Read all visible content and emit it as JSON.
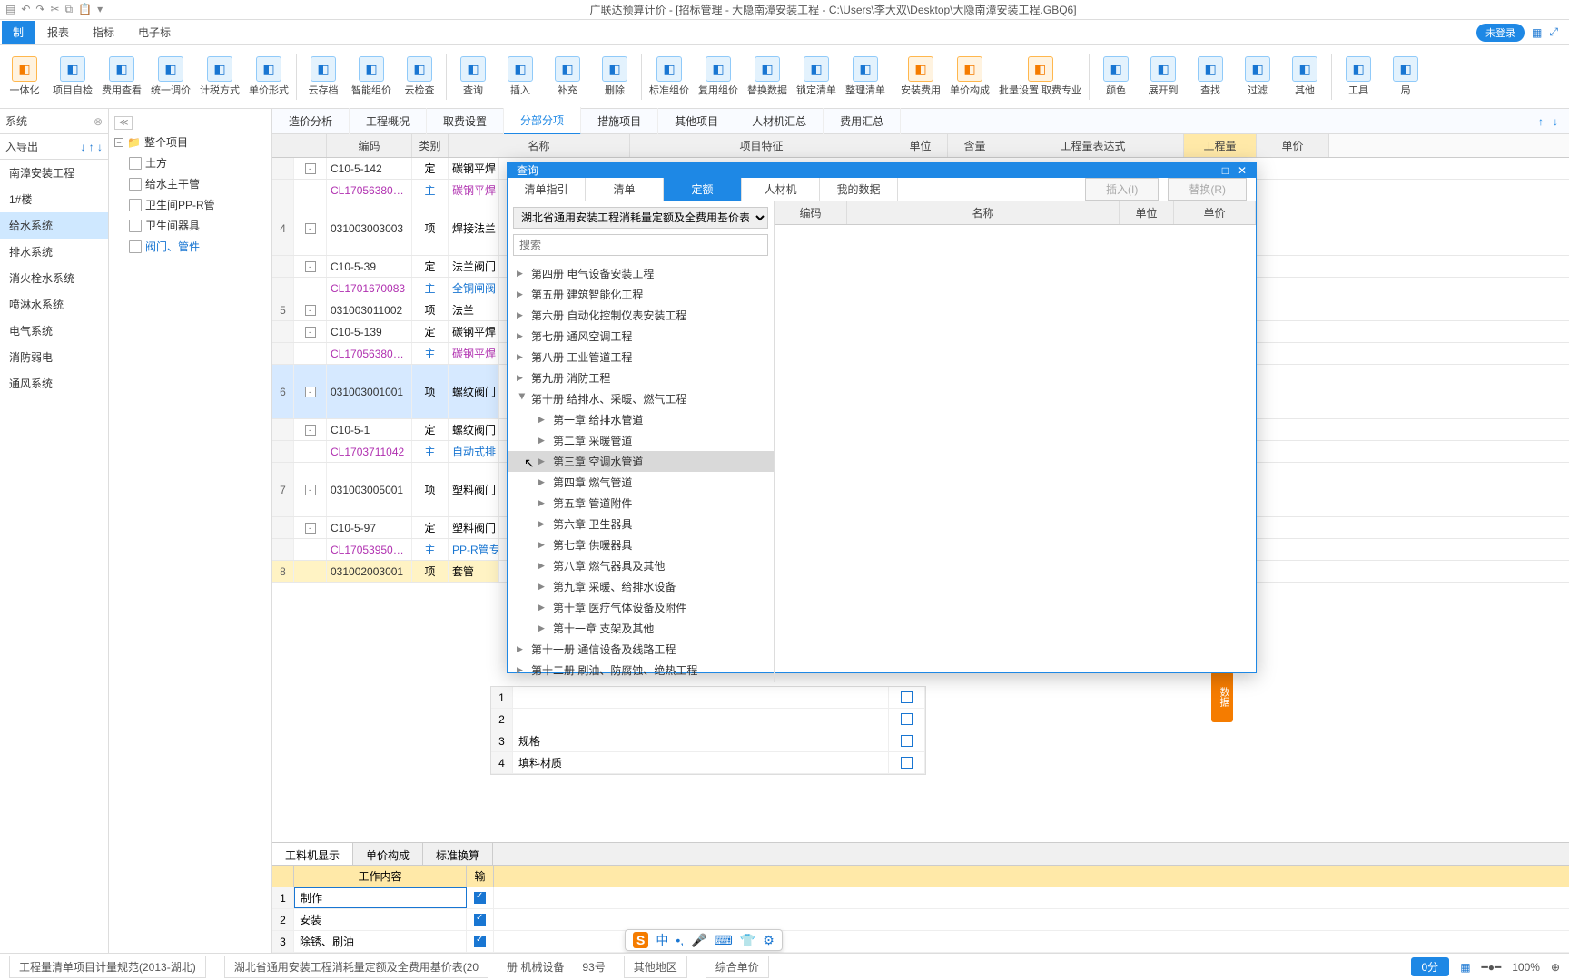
{
  "titlebar": {
    "title": "广联达预算计价 - [招标管理 - 大隐南漳安装工程 - C:\\Users\\李大双\\Desktop\\大隐南漳安装工程.GBQ6]"
  },
  "menubar": {
    "tabs": [
      "制",
      "报表",
      "指标",
      "电子标"
    ],
    "login": "未登录"
  },
  "ribbon": [
    {
      "label": "一体化",
      "v": "o"
    },
    {
      "label": "项目自检"
    },
    {
      "label": "费用查看"
    },
    {
      "label": "统一调价"
    },
    {
      "label": "计税方式"
    },
    {
      "label": "单价形式"
    },
    {
      "sep": true
    },
    {
      "label": "云存档"
    },
    {
      "label": "智能组价"
    },
    {
      "label": "云检查"
    },
    {
      "sep": true
    },
    {
      "label": "查询"
    },
    {
      "label": "插入"
    },
    {
      "label": "补充"
    },
    {
      "label": "删除"
    },
    {
      "sep": true
    },
    {
      "label": "标准组价"
    },
    {
      "label": "复用组价"
    },
    {
      "label": "替换数据"
    },
    {
      "label": "锁定清单"
    },
    {
      "label": "整理清单"
    },
    {
      "sep": true
    },
    {
      "label": "安装费用",
      "v": "o"
    },
    {
      "label": "单价构成",
      "v": "o"
    },
    {
      "label": "批量设置\n取费专业",
      "v": "o"
    },
    {
      "sep": true
    },
    {
      "label": "颜色"
    },
    {
      "label": "展开到"
    },
    {
      "label": "查找"
    },
    {
      "label": "过滤"
    },
    {
      "label": "其他"
    },
    {
      "sep": true
    },
    {
      "label": "工具"
    },
    {
      "label": "局"
    }
  ],
  "left_nav": {
    "header": "系统",
    "toolbar": "入导出",
    "items": [
      "南漳安装工程",
      "1#楼",
      "给水系统",
      "排水系统",
      "消火栓水系统",
      "喷淋水系统",
      "电气系统",
      "消防弱电",
      "通风系统"
    ],
    "selected_index": 2
  },
  "doc_tree": {
    "header": "整个项目",
    "items": [
      "土方",
      "给水主干管",
      "卫生间PP-R管",
      "卫生间器具",
      "阀门、管件"
    ]
  },
  "subtabs": [
    "造价分析",
    "工程概况",
    "取费设置",
    "分部分项",
    "措施项目",
    "其他项目",
    "人材机汇总",
    "费用汇总"
  ],
  "subtab_active": 3,
  "grid_headers": [
    "",
    "编码",
    "类别",
    "名称",
    "项目特征",
    "单位",
    "含量",
    "工程量表达式",
    "工程量",
    "单价"
  ],
  "grid_active_header_index": 8,
  "rows": [
    {
      "num": "",
      "exp": "-",
      "code": "C10-5-142",
      "cat": "定",
      "name": "碳钢平焊"
    },
    {
      "num": "",
      "exp": "",
      "code": "CL17056380…",
      "cat": "主",
      "name": "碳钢平焊",
      "purple": true
    },
    {
      "num": "4",
      "exp": "-",
      "code": "031003003003",
      "cat": "项",
      "name": "焊接法兰",
      "tall": true
    },
    {
      "num": "",
      "exp": "-",
      "code": "C10-5-39",
      "cat": "定",
      "name": "法兰阀门"
    },
    {
      "num": "",
      "exp": "",
      "code": "CL1701670083",
      "cat": "主",
      "name": "全铜闸阀",
      "purple": true,
      "blue_name": true
    },
    {
      "num": "5",
      "exp": "-",
      "code": "031003011002",
      "cat": "项",
      "name": "法兰"
    },
    {
      "num": "",
      "exp": "-",
      "code": "C10-5-139",
      "cat": "定",
      "name": "碳钢平焊"
    },
    {
      "num": "",
      "exp": "",
      "code": "CL17056380…",
      "cat": "主",
      "name": "碳钢平焊",
      "purple": true
    },
    {
      "num": "6",
      "exp": "-",
      "code": "031003001001",
      "cat": "项",
      "name": "螺纹阀门",
      "tall": true,
      "sel": true
    },
    {
      "num": "",
      "exp": "-",
      "code": "C10-5-1",
      "cat": "定",
      "name": "螺纹阀门"
    },
    {
      "num": "",
      "exp": "",
      "code": "CL1703711042",
      "cat": "主",
      "name": "自动式排",
      "purple": true,
      "blue_name": true
    },
    {
      "num": "7",
      "exp": "-",
      "code": "031003005001",
      "cat": "项",
      "name": "塑料阀门",
      "tall": true
    },
    {
      "num": "",
      "exp": "-",
      "code": "C10-5-97",
      "cat": "定",
      "name": "塑料阀门"
    },
    {
      "num": "",
      "exp": "",
      "code": "CL17053950…",
      "cat": "主",
      "name": "PP-R管专",
      "purple": true,
      "blue_name": true
    },
    {
      "num": "8",
      "exp": "",
      "code": "031002003001",
      "cat": "项",
      "name": "套管",
      "cur": true
    }
  ],
  "bottom_tabs": [
    "工料机显示",
    "单价构成",
    "标准换算"
  ],
  "bottom_header": "工作内容",
  "bottom_h2": "输",
  "bottom_rows": [
    {
      "n": "1",
      "t": "制作",
      "c": true,
      "sel": true
    },
    {
      "n": "2",
      "t": "安装",
      "c": true
    },
    {
      "n": "3",
      "t": "除锈、刷油",
      "c": true
    }
  ],
  "right_rows": [
    {
      "n": "1",
      "t": ""
    },
    {
      "n": "2",
      "t": ""
    },
    {
      "n": "3",
      "t": "规格"
    },
    {
      "n": "4",
      "t": "填料材质"
    }
  ],
  "dialog": {
    "title": "查询",
    "tabs": [
      "清单指引",
      "清单",
      "定额",
      "人材机",
      "我的数据"
    ],
    "active_tab": 2,
    "btn_insert": "插入(I)",
    "btn_replace": "替换(R)",
    "dropdown": "湖北省通用安装工程消耗量定额及全费用基价表(2…",
    "search_placeholder": "搜索",
    "tree": [
      {
        "t": "第四册 电气设备安装工程",
        "l": 1
      },
      {
        "t": "第五册 建筑智能化工程",
        "l": 1
      },
      {
        "t": "第六册 自动化控制仪表安装工程",
        "l": 1
      },
      {
        "t": "第七册 通风空调工程",
        "l": 1
      },
      {
        "t": "第八册 工业管道工程",
        "l": 1
      },
      {
        "t": "第九册 消防工程",
        "l": 1
      },
      {
        "t": "第十册 给排水、采暖、燃气工程",
        "l": 1,
        "exp": true
      },
      {
        "t": "第一章 给排水管道",
        "l": 2
      },
      {
        "t": "第二章 采暖管道",
        "l": 2
      },
      {
        "t": "第三章 空调水管道",
        "l": 2,
        "hl": true
      },
      {
        "t": "第四章 燃气管道",
        "l": 2
      },
      {
        "t": "第五章 管道附件",
        "l": 2
      },
      {
        "t": "第六章 卫生器具",
        "l": 2
      },
      {
        "t": "第七章 供暖器具",
        "l": 2
      },
      {
        "t": "第八章 燃气器具及其他",
        "l": 2
      },
      {
        "t": "第九章 采暖、给排水设备",
        "l": 2
      },
      {
        "t": "第十章 医疗气体设备及附件",
        "l": 2
      },
      {
        "t": "第十一章 支架及其他",
        "l": 2
      },
      {
        "t": "第十一册 通信设备及线路工程",
        "l": 1
      },
      {
        "t": "第十二册 刷油、防腐蚀、绝热工程",
        "l": 1
      }
    ],
    "right_headers": [
      "编码",
      "名称",
      "单位",
      "单价"
    ]
  },
  "statusbar": {
    "s1": "工程量清单项目计量规范(2013-湖北)",
    "s2": "湖北省通用安装工程消耗量定额及全费用基价表(20",
    "s3": "册 机械设备",
    "s4": "93号",
    "s5": "其他地区",
    "s6": "综合单价",
    "score": "0分",
    "zoom": "100%"
  },
  "orange_tab": "数据",
  "ime": {
    "logo": "S",
    "mid": "中"
  }
}
